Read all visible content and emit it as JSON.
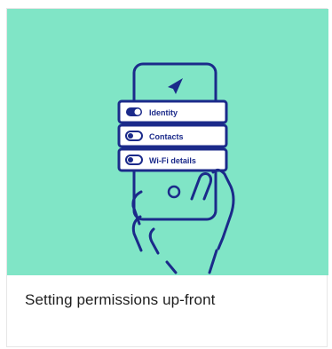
{
  "card": {
    "title": "Setting permissions up-front",
    "illustration": {
      "background_color": "#80e5c6",
      "line_color": "#1b2a8a",
      "permissions": [
        {
          "label": "Identity",
          "enabled": true
        },
        {
          "label": "Contacts",
          "enabled": false
        },
        {
          "label": "Wi-Fi details",
          "enabled": false
        }
      ],
      "icon": "paper-plane-icon"
    }
  }
}
